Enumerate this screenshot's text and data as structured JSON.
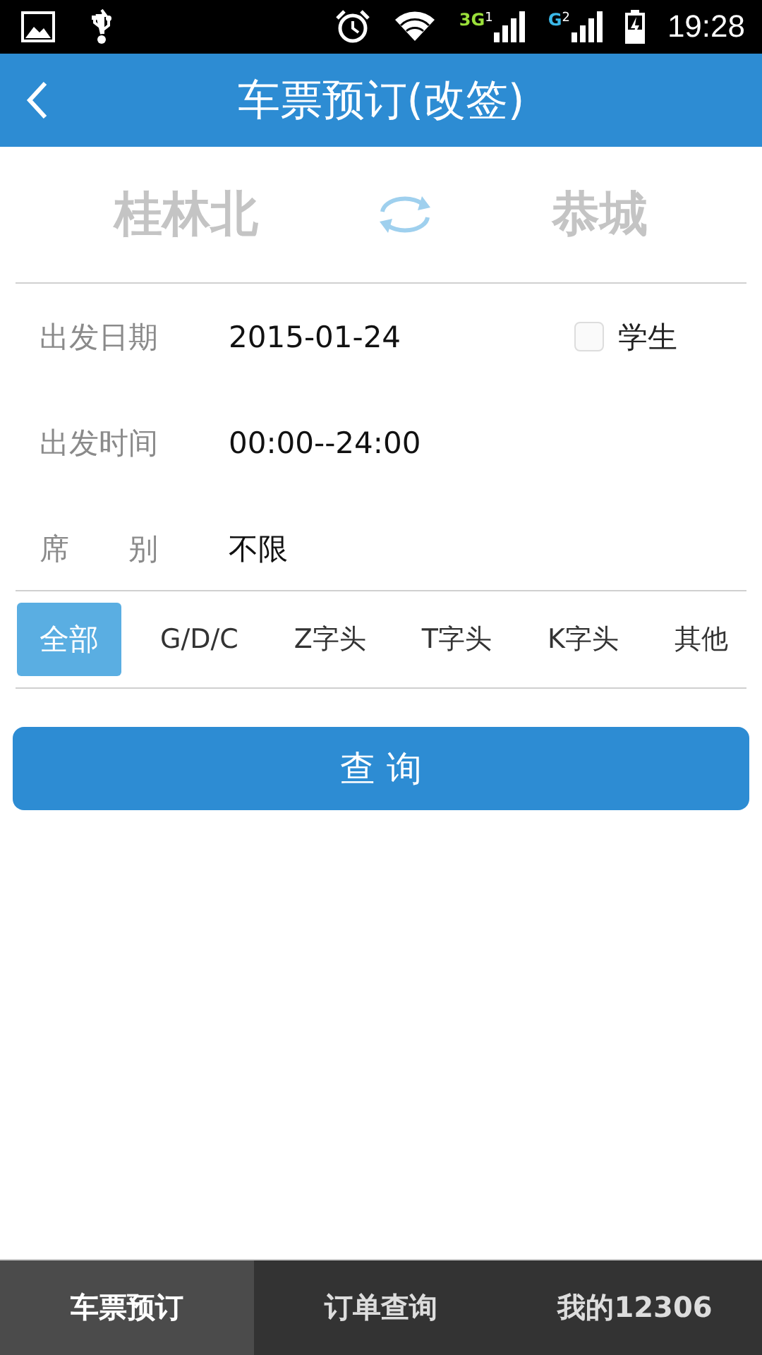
{
  "status_bar": {
    "networks": [
      {
        "label": "3G",
        "sim": "1",
        "color": "#9be03a"
      },
      {
        "label": "G",
        "sim": "2",
        "color": "#3ab8e8"
      }
    ],
    "time": "19:28"
  },
  "header": {
    "title": "车票预订(改签)"
  },
  "stations": {
    "from": "桂林北",
    "to": "恭城"
  },
  "fields": [
    {
      "label": "出发日期",
      "value": "2015-01-24"
    },
    {
      "label": "出发时间",
      "value": "00:00--24:00"
    },
    {
      "label": "席　　别",
      "value": "不限"
    }
  ],
  "student": {
    "label": "学生",
    "checked": false
  },
  "train_types": [
    {
      "label": "全部",
      "selected": true
    },
    {
      "label": "G/D/C",
      "selected": false
    },
    {
      "label": "Z字头",
      "selected": false
    },
    {
      "label": "T字头",
      "selected": false
    },
    {
      "label": "K字头",
      "selected": false
    },
    {
      "label": "其他",
      "selected": false
    }
  ],
  "search_button": "查 询",
  "bottom_nav": [
    {
      "label": "车票预订",
      "selected": true
    },
    {
      "label": "订单查询",
      "selected": false
    },
    {
      "label": "我的12306",
      "selected": false
    }
  ]
}
